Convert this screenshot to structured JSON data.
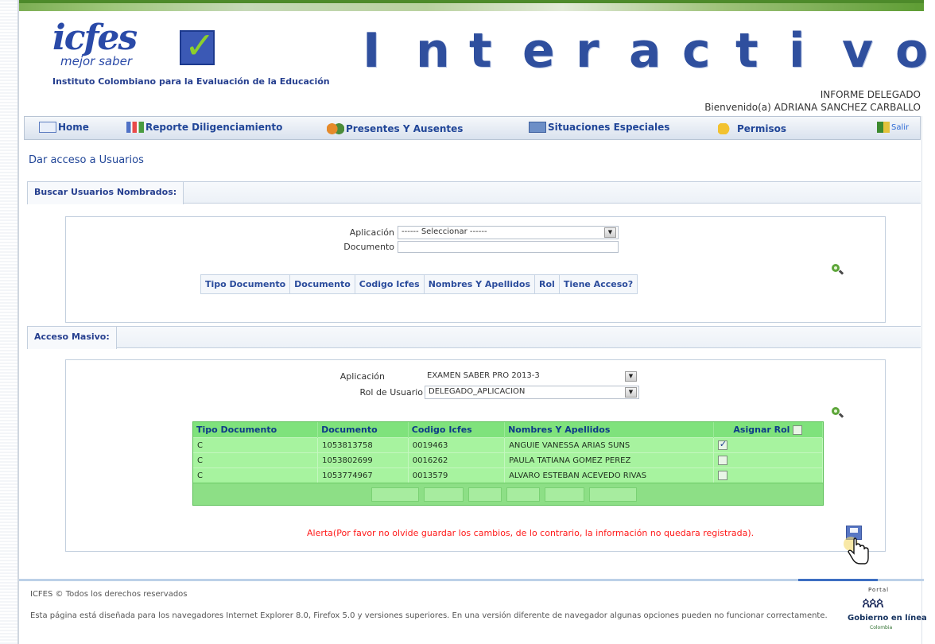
{
  "header": {
    "logo_word": "icfes",
    "logo_sub": "mejor saber",
    "institute": "Instituto Colombiano para la Evaluación de la Educación",
    "banner_letters": [
      "I",
      "n",
      "t",
      "e",
      "r",
      "a",
      "c",
      "t",
      "i",
      "v",
      "o"
    ],
    "report_title": "INFORME DELEGADO",
    "welcome": "Bienvenido(a) ADRIANA SANCHEZ CARBALLO"
  },
  "nav": {
    "home": "Home",
    "report": "Reporte Diligenciamiento",
    "present": "Presentes Y Ausentes",
    "special": "Situaciones Especiales",
    "permissions": "Permisos",
    "exit": "Salir"
  },
  "page_title": "Dar acceso a Usuarios",
  "search_section": {
    "tab": "Buscar Usuarios Nombrados:",
    "application_label": "Aplicación",
    "application_value": "------ Seleccionar ------",
    "document_label": "Documento",
    "document_value": "",
    "columns": [
      "Tipo Documento",
      "Documento",
      "Codigo Icfes",
      "Nombres Y Apellidos",
      "Rol",
      "Tiene Acceso?"
    ]
  },
  "bulk_section": {
    "tab": "Acceso Masivo:",
    "application_label": "Aplicación",
    "application_value": "EXAMEN SABER PRO 2013-3",
    "role_label": "Rol de Usuario",
    "role_value": "DELEGADO_APLICACION",
    "columns": [
      "Tipo Documento",
      "Documento",
      "Codigo Icfes",
      "Nombres Y Apellidos",
      "Asignar Rol"
    ],
    "rows": [
      {
        "tipo": "C",
        "documento": "1053813758",
        "codigo": "0019463",
        "nombre": "ANGUIE VANESSA ARIAS SUNS",
        "asignado": true
      },
      {
        "tipo": "C",
        "documento": "1053802699",
        "codigo": "0016262",
        "nombre": "PAULA TATIANA GOMEZ PEREZ",
        "asignado": false
      },
      {
        "tipo": "C",
        "documento": "1053774967",
        "codigo": "0013579",
        "nombre": "ALVARO ESTEBAN ACEVEDO RIVAS",
        "asignado": false
      }
    ],
    "alert": "Alerta(Por favor no olvide guardar los cambios, de lo contrario, la información no quedara registrada)."
  },
  "footer": {
    "copyright": "ICFES © Todos los derechos reservados",
    "browser_note": "Esta página está diseñada para los navegadores Internet Explorer 8.0, Firefox 5.0 y versiones superiores. En una versión diferente de navegador algunas opciones pueden no funcionar correctamente.",
    "gov_top": "Portal",
    "gov_name": "Gobierno en línea",
    "gov_country": "Colombia"
  },
  "colors": {
    "brand_blue": "#2a4aa8",
    "grid_green": "#7fe27c",
    "alert_red": "#ff1a1a"
  }
}
